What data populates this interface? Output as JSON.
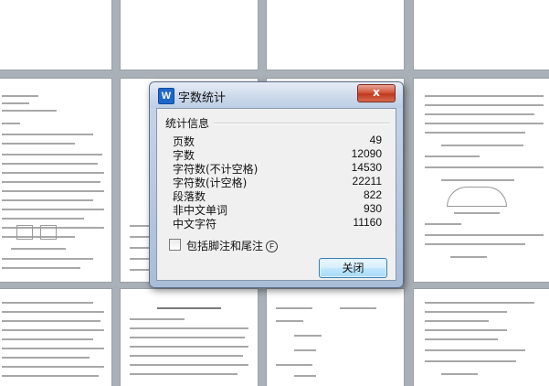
{
  "dialog": {
    "title": "字数统计",
    "logo_letter": "W",
    "close_glyph": "x",
    "group_label": "统计信息",
    "stats": [
      {
        "label": "页数",
        "value": "49"
      },
      {
        "label": "字数",
        "value": "12090"
      },
      {
        "label": "字符数(不计空格)",
        "value": "14530"
      },
      {
        "label": "字符数(计空格)",
        "value": "22211"
      },
      {
        "label": "段落数",
        "value": "822"
      },
      {
        "label": "非中文单词",
        "value": "930"
      },
      {
        "label": "中文字符",
        "value": "11160"
      }
    ],
    "checkbox_label": "包括脚注和尾注",
    "checkbox_hotkey": "F",
    "checkbox_checked": false,
    "close_button": "关闭"
  },
  "colors": {
    "dialog_frame": "#a9bdd8",
    "close_button": "#c0391f",
    "workspace": "#a9b0b7",
    "logo": "#1e67c8"
  }
}
